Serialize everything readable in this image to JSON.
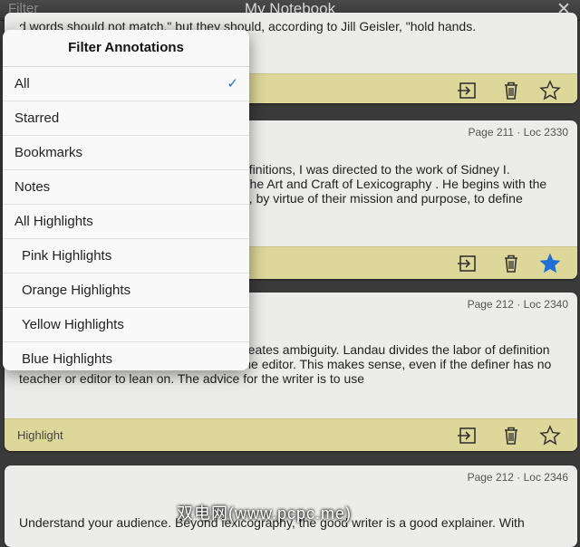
{
  "topbar": {
    "filter_label": "Filter",
    "title": "My Notebook",
    "close_glyph": "✕"
  },
  "cards": [
    {
      "text": "d words should not match,\" but they should, according to Jill Geisler, \"hold hands.",
      "starred": false
    },
    {
      "meta": "Page 211 · Loc 2330",
      "text": "efinitions, I was directed to the work of Sidney I.\nThe Art and Craft of Lexicography . He begins with the\nd, by virtue of their mission and purpose, to define",
      "starred": true
    },
    {
      "meta": "Page 212 · Loc 2340",
      "text_line1": "reates ambiguity. Landau divides the labor of definition",
      "text_rest": "between the writer of the definition and the editor. This makes sense, even if the definer has no\nteacher or editor to lean on. The advice for the writer is to use",
      "label": "Highlight",
      "starred": false
    },
    {
      "meta": "Page 212 · Loc 2346",
      "text": "Understand your audience. Beyond lexicography, the good writer is a good explainer. With"
    }
  ],
  "popover": {
    "title": "Filter Annotations",
    "items": [
      {
        "label": "All",
        "selected": true
      },
      {
        "label": "Starred"
      },
      {
        "label": "Bookmarks"
      },
      {
        "label": "Notes"
      },
      {
        "label": "All Highlights"
      },
      {
        "label": "Pink Highlights"
      },
      {
        "label": "Orange Highlights"
      },
      {
        "label": "Yellow Highlights"
      },
      {
        "label": "Blue Highlights"
      }
    ],
    "check_glyph": "✓"
  },
  "colors": {
    "highlight_bar": "#ddd79a",
    "star_active": "#1f6fd6",
    "accent": "#1f6fd6"
  },
  "watermark": "双电网(www.pcpc.me)"
}
